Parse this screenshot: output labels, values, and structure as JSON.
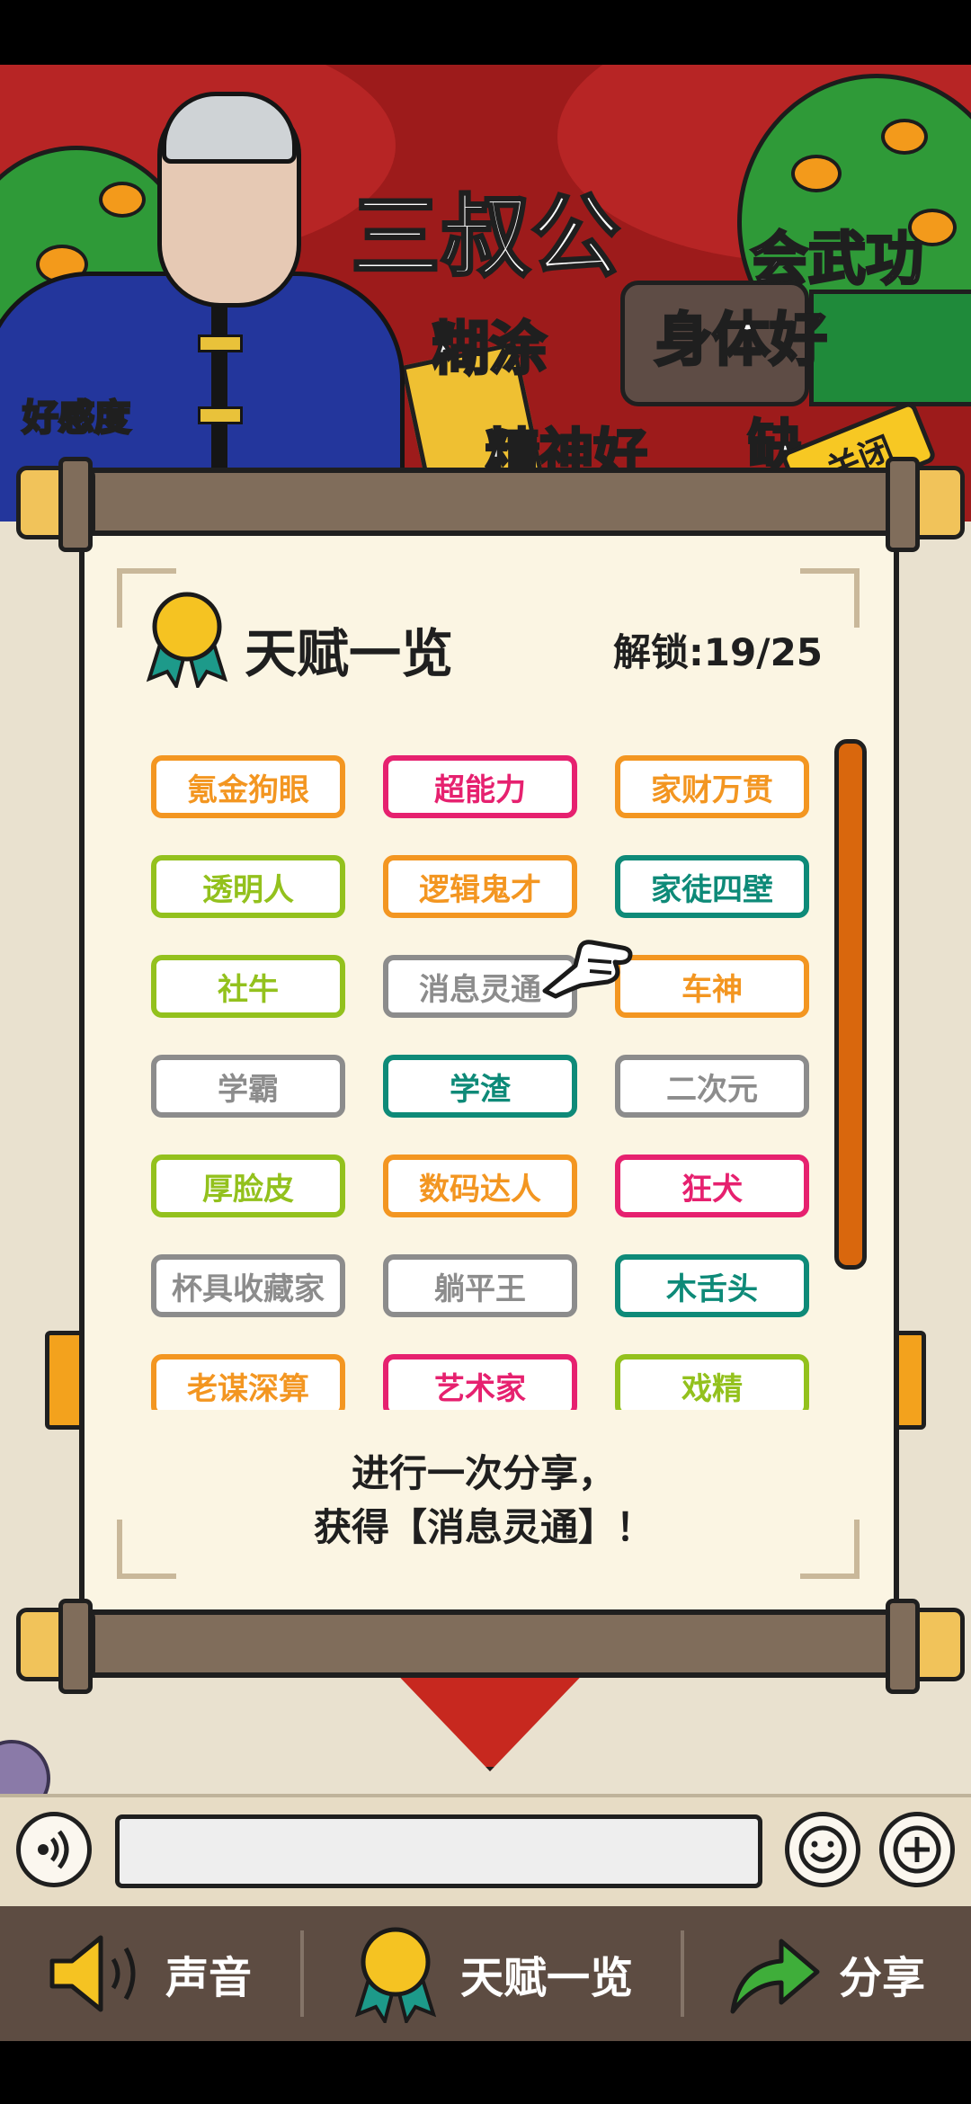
{
  "scene": {
    "character_name": "三叔公",
    "affection_label": "好感度",
    "traits": [
      "会武功",
      "糊涂",
      "身体好",
      "精神好",
      "缺"
    ],
    "close_label": "关闭"
  },
  "panel": {
    "title": "天赋一览",
    "unlock_label": "解锁:19/25",
    "talents": [
      {
        "label": "氪金狗眼",
        "color": "#f39621"
      },
      {
        "label": "超能力",
        "color": "#e6216f"
      },
      {
        "label": "家财万贯",
        "color": "#f39621"
      },
      {
        "label": "透明人",
        "color": "#93c11d"
      },
      {
        "label": "逻辑鬼才",
        "color": "#f39621"
      },
      {
        "label": "家徒四壁",
        "color": "#0e8a78"
      },
      {
        "label": "社牛",
        "color": "#93c11d"
      },
      {
        "label": "消息灵通",
        "color": "#8c8c8c"
      },
      {
        "label": "车神",
        "color": "#f39621"
      },
      {
        "label": "学霸",
        "color": "#8c8c8c"
      },
      {
        "label": "学渣",
        "color": "#0e8a78"
      },
      {
        "label": "二次元",
        "color": "#8c8c8c"
      },
      {
        "label": "厚脸皮",
        "color": "#93c11d"
      },
      {
        "label": "数码达人",
        "color": "#f39621"
      },
      {
        "label": "狂犬",
        "color": "#e6216f"
      },
      {
        "label": "杯具收藏家",
        "color": "#8c8c8c"
      },
      {
        "label": "躺平王",
        "color": "#8c8c8c"
      },
      {
        "label": "木舌头",
        "color": "#0e8a78"
      },
      {
        "label": "老谋深算",
        "color": "#f39621"
      },
      {
        "label": "艺术家",
        "color": "#e6216f"
      },
      {
        "label": "戏精",
        "color": "#93c11d"
      }
    ],
    "hint_line1": "进行一次分享，",
    "hint_line2": "获得【消息灵通】！"
  },
  "nav": {
    "sound_label": "声音",
    "talents_label": "天赋一览",
    "share_label": "分享"
  }
}
